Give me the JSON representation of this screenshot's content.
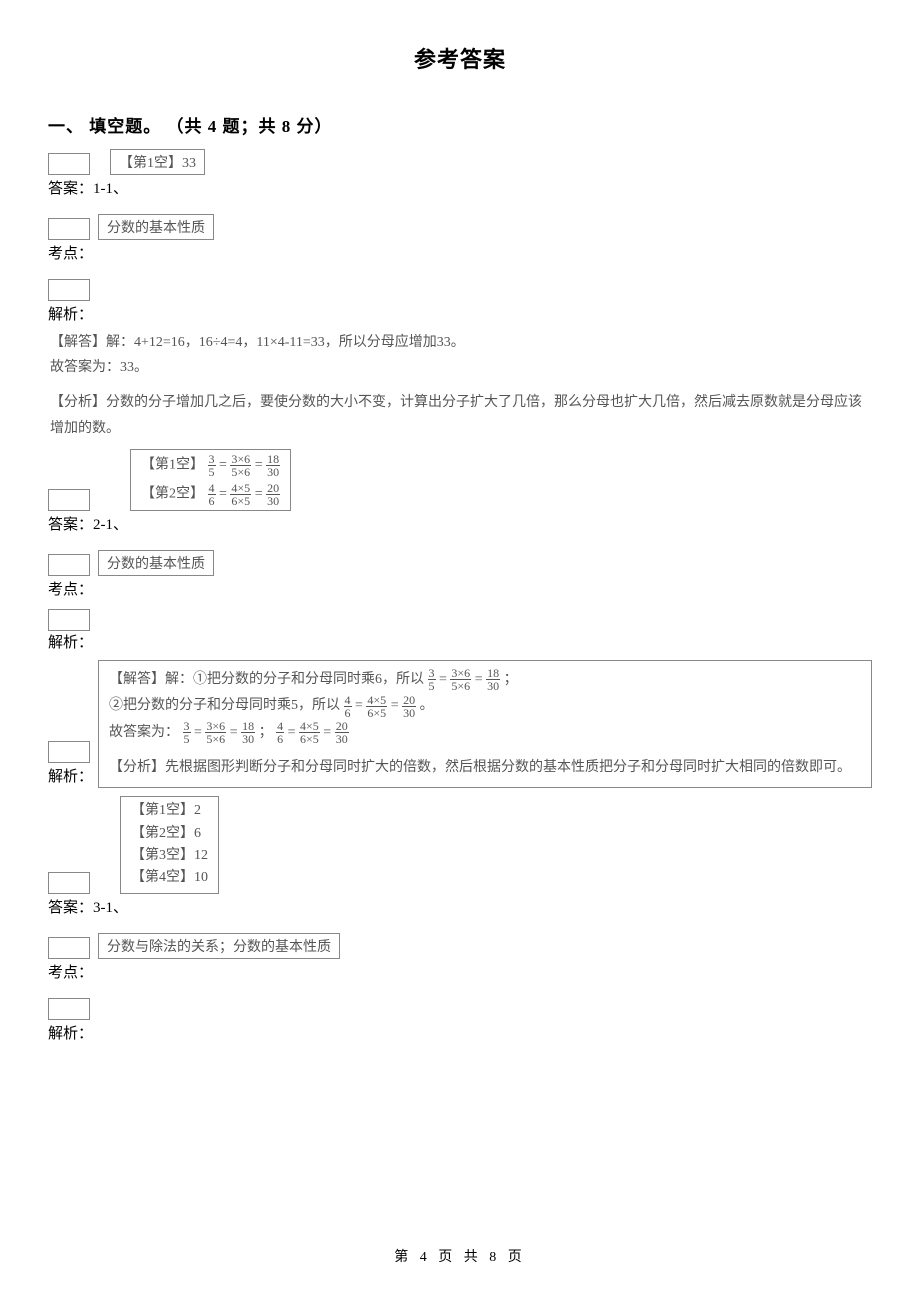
{
  "page_title": "参考答案",
  "section_header": "一、 填空题。 （共 4 题；共 8 分）",
  "q1": {
    "ans_label": "答案：1-1、",
    "ans_box": "【第1空】33",
    "topic_label": "考点：",
    "topic_box": "分数的基本性质",
    "analysis_label": "解析：",
    "analysis_line1": "【解答】解：4+12=16，16÷4=4，11×4-11=33，所以分母应增加33。",
    "analysis_line2": "故答案为：33。",
    "analysis_line3": "【分析】分数的分子增加几之后，要使分数的大小不变，计算出分子扩大了几倍，那么分母也扩大几倍，然后减去原数就是分母应该增加的数。"
  },
  "q2": {
    "ans_label": "答案：2-1、",
    "blank1_prefix": "【第1空】",
    "blank2_prefix": "【第2空】",
    "f1": {
      "a": "3",
      "b": "5",
      "c": "3×6",
      "d": "5×6",
      "e": "18",
      "f": "30"
    },
    "f2": {
      "a": "4",
      "b": "6",
      "c": "4×5",
      "d": "6×5",
      "e": "20",
      "f": "30"
    },
    "topic_label": "考点：",
    "topic_box": "分数的基本性质",
    "jieda_prefix": "【解答】解：①把分数的分子和分母同时乘6，所以",
    "jieda_suffix": " ；",
    "jieda2_prefix": "②把分数的分子和分母同时乘5，所以",
    "jieda2_suffix": "。",
    "guda_prefix": "故答案为：",
    "guda_mid": " ；",
    "fenxi": "【分析】先根据图形判断分子和分母同时扩大的倍数，然后根据分数的基本性质把分子和分母同时扩大相同的倍数即可。",
    "analysis_label": "解析："
  },
  "q3": {
    "ans_label": "答案：3-1、",
    "b1": "【第1空】2",
    "b2": "【第2空】6",
    "b3": "【第3空】12",
    "b4": "【第4空】10",
    "topic_label": "考点：",
    "topic_box": "分数与除法的关系；分数的基本性质",
    "analysis_label": "解析："
  },
  "footer": "第 4 页 共 8 页"
}
